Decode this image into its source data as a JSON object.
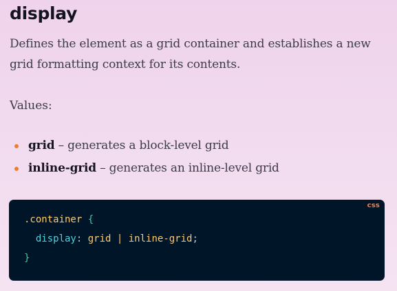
{
  "section": {
    "heading": "display",
    "description": "Defines the element as a grid container and establishes a new grid formatting context for its contents.",
    "values_label": "Values:",
    "values": [
      {
        "name": "grid",
        "text": " – generates a block-level grid"
      },
      {
        "name": "inline-grid",
        "text": " – generates an inline-level grid"
      }
    ]
  },
  "code_block": {
    "language": "css",
    "selector": ".container",
    "open_brace": "{",
    "property": "display",
    "colon": ":",
    "value": "grid | inline-grid",
    "semicolon": ";",
    "close_brace": "}"
  },
  "colors": {
    "bullet": "#ee7c2e",
    "code_background": "#001628",
    "language_label": "#fb7a3d"
  }
}
